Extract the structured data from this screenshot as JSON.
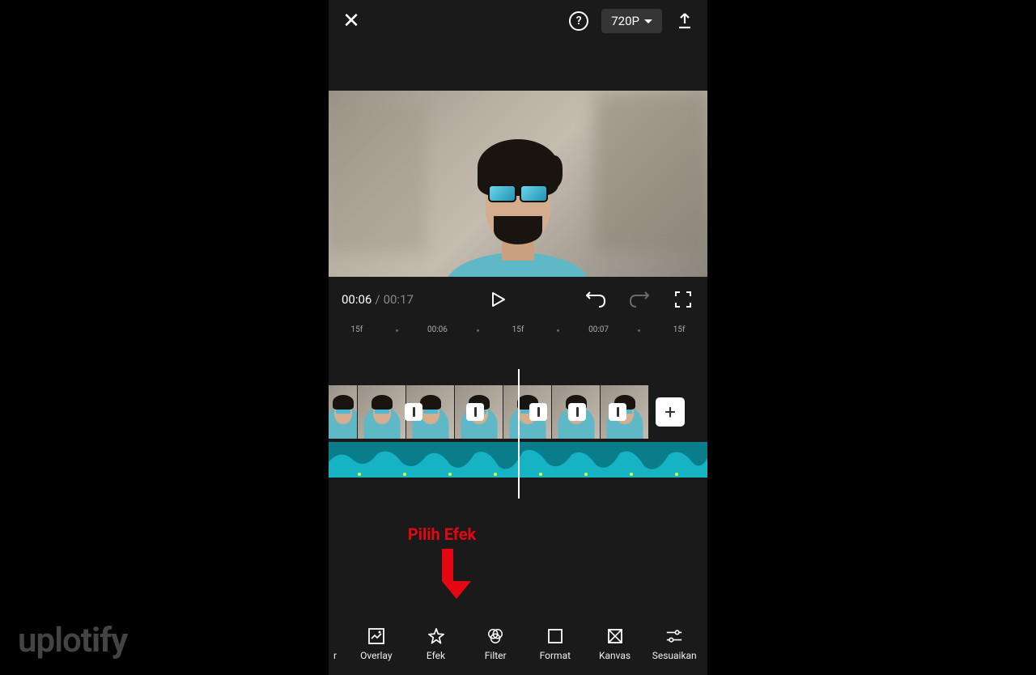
{
  "header": {
    "resolution": "720P"
  },
  "player": {
    "current_time": "00:06",
    "separator": "/",
    "total_time": "00:17"
  },
  "ruler": {
    "t0": "15f",
    "t1": "00:06",
    "t2": "15f",
    "t3": "00:07",
    "t4": "15f"
  },
  "timeline": {
    "add_label": "+"
  },
  "annotation": {
    "text": "Pilih Efek"
  },
  "toolbar": {
    "partial": "r",
    "overlay": "Overlay",
    "efek": "Efek",
    "filter": "Filter",
    "format": "Format",
    "kanvas": "Kanvas",
    "sesuaikan": "Sesuaikan"
  },
  "watermark": {
    "part1": "uplo",
    "part2": "tify"
  }
}
